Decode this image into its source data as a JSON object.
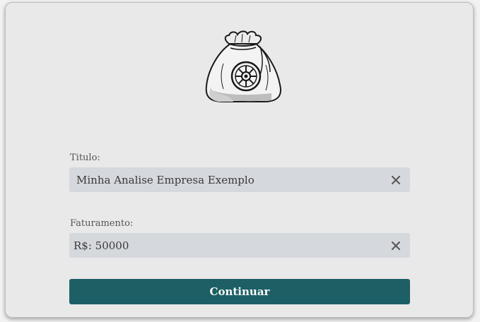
{
  "form": {
    "titulo_label": "Titulo:",
    "titulo_value": "Minha Analise Empresa Exemplo",
    "faturamento_label": "Faturamento:",
    "faturamento_value": "R$: 50000",
    "continue_label": "Continuar"
  },
  "icons": {
    "logo": "money-bag-icon",
    "clear": "close-icon"
  },
  "colors": {
    "primary": "#1e5f66",
    "field_bg": "#d5d8dc",
    "card_bg": "#e9e9e9"
  }
}
